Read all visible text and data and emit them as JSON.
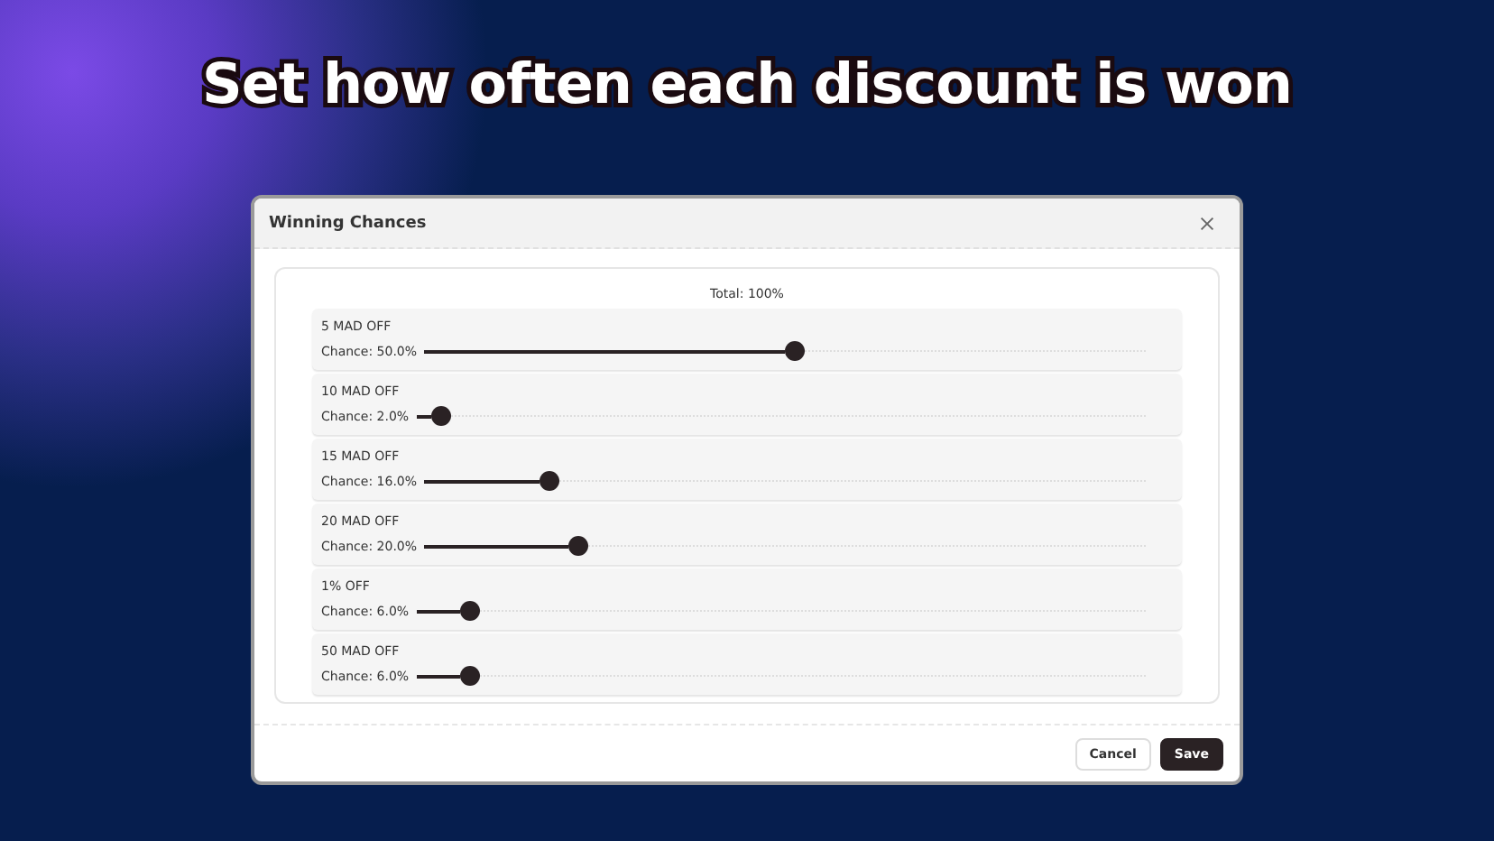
{
  "headline": "Set how often each discount is won",
  "dialog": {
    "title": "Winning Chances",
    "total": "Total: 100%",
    "prizes": [
      {
        "name": "5 MAD OFF",
        "reading": "Chance: 50.0%",
        "level": 0.5
      },
      {
        "name": "10 MAD OFF",
        "reading": "Chance: 2.0%",
        "level": 0.02
      },
      {
        "name": "15 MAD OFF",
        "reading": "Chance: 16.0%",
        "level": 0.16
      },
      {
        "name": "20 MAD OFF",
        "reading": "Chance: 20.0%",
        "level": 0.2
      },
      {
        "name": "1% OFF",
        "reading": "Chance: 6.0%",
        "level": 0.06
      },
      {
        "name": "50 MAD OFF",
        "reading": "Chance: 6.0%",
        "level": 0.06
      }
    ],
    "buttons": [
      "Cancel",
      "Save"
    ]
  }
}
